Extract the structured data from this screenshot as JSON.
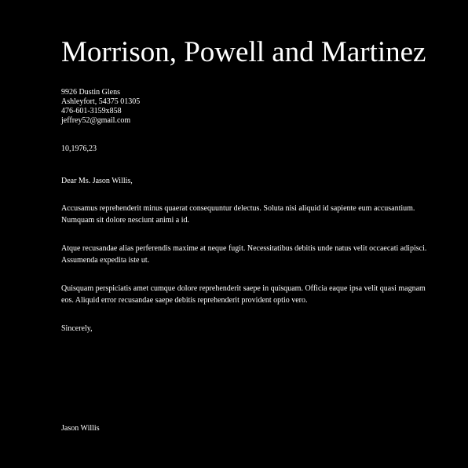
{
  "letter": {
    "sender_company": "Morrison, Powell and Martinez",
    "sender_address": {
      "street": "9926 Dustin Glens",
      "city_line": "Ashleyfort, 54375 01305",
      "phone": "476-601-3159x858",
      "email": "jeffrey52@gmail.com"
    },
    "date": "10,1976,23",
    "salutation": "Dear Ms. Jason Willis,",
    "paragraphs": [
      "Accusamus reprehenderit minus quaerat consequuntur delectus. Soluta nisi aliquid id sapiente eum accusantium. Numquam sit dolore nesciunt animi a id.",
      "Atque recusandae alias perferendis maxime at neque fugit. Necessitatibus debitis unde natus velit occaecati adipisci. Assumenda expedita iste ut.",
      "Quisquam perspiciatis amet cumque dolore reprehenderit saepe in quisquam. Officia eaque ipsa velit quasi magnam eos. Aliquid error recusandae saepe debitis reprehenderit provident optio vero."
    ],
    "closing": "Sincerely,",
    "signature_name": "Jason Willis"
  },
  "colors": {
    "background": "#000000",
    "text": "#ffffff"
  }
}
